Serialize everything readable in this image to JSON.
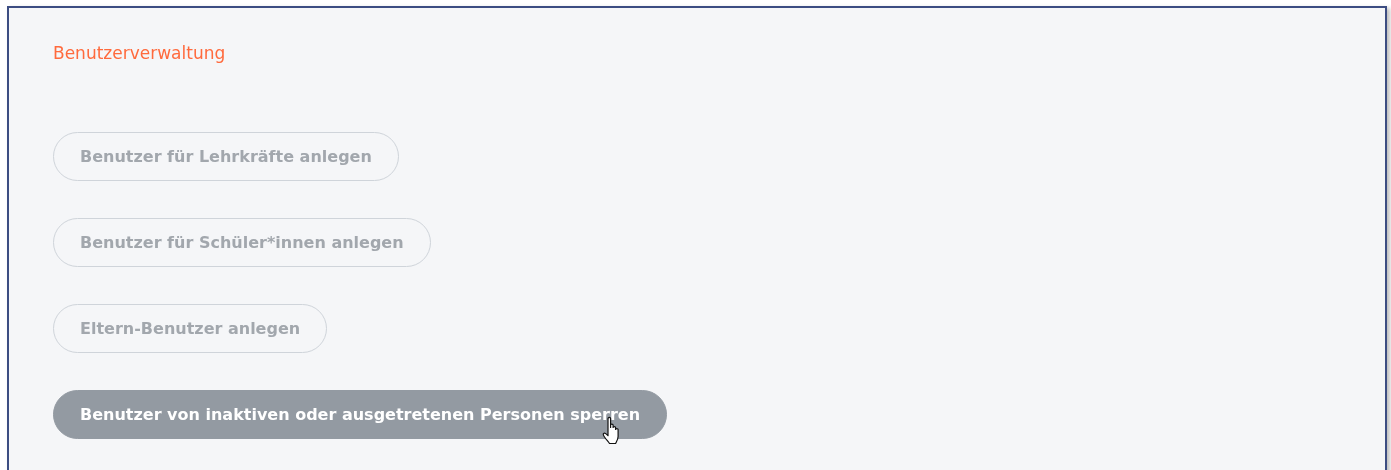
{
  "panel": {
    "title": "Benutzerverwaltung"
  },
  "buttons": [
    {
      "label": "Benutzer für Lehrkräfte anlegen",
      "hovered": false
    },
    {
      "label": "Benutzer für Schüler*innen anlegen",
      "hovered": false
    },
    {
      "label": "Eltern-Benutzer anlegen",
      "hovered": false
    },
    {
      "label": "Benutzer von inaktiven oder ausgetretenen Personen sperren",
      "hovered": true
    }
  ]
}
